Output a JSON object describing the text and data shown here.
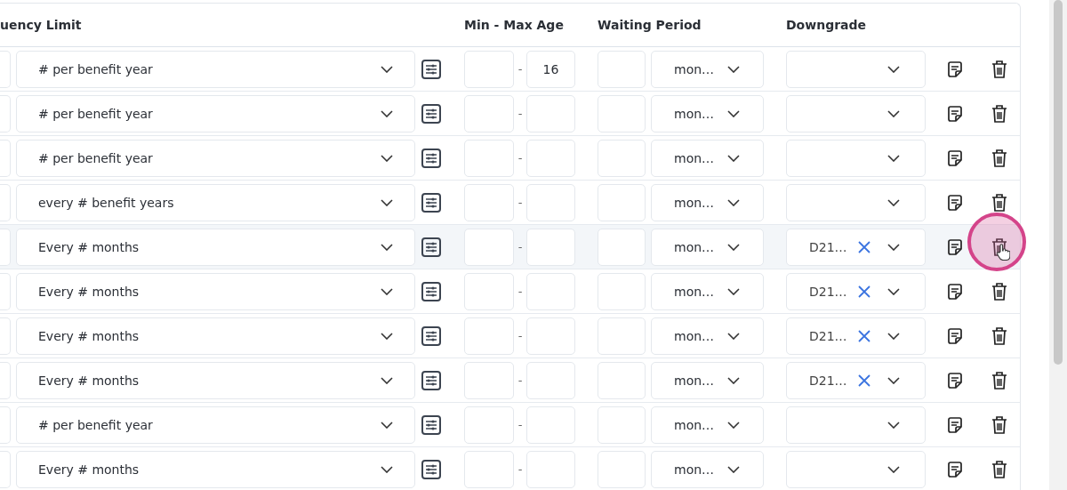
{
  "table": {
    "columns": [
      "uency Limit",
      "Min - Max Age",
      "Waiting Period",
      "Downgrade"
    ],
    "rows": [
      {
        "frequency": "# per benefit year",
        "age_separator": "-",
        "max_age": "16",
        "waiting_unit": "mon…",
        "downgrade": null,
        "hovered": false
      },
      {
        "frequency": "# per benefit year",
        "age_separator": "-",
        "max_age": null,
        "waiting_unit": "mon…",
        "downgrade": null,
        "hovered": false
      },
      {
        "frequency": "# per benefit year",
        "age_separator": "-",
        "max_age": null,
        "waiting_unit": "mon…",
        "downgrade": null,
        "hovered": false
      },
      {
        "frequency": "every # benefit years",
        "age_separator": "-",
        "max_age": null,
        "waiting_unit": "mon…",
        "downgrade": null,
        "hovered": false
      },
      {
        "frequency": "Every # months",
        "age_separator": "-",
        "max_age": null,
        "waiting_unit": "mon…",
        "downgrade": "D21…",
        "hovered": true
      },
      {
        "frequency": "Every # months",
        "age_separator": "-",
        "max_age": null,
        "waiting_unit": "mon…",
        "downgrade": "D21…",
        "hovered": false
      },
      {
        "frequency": "Every # months",
        "age_separator": "-",
        "max_age": null,
        "waiting_unit": "mon…",
        "downgrade": "D21…",
        "hovered": false
      },
      {
        "frequency": "Every # months",
        "age_separator": "-",
        "max_age": null,
        "waiting_unit": "mon…",
        "downgrade": "D21…",
        "hovered": false
      },
      {
        "frequency": "# per benefit year",
        "age_separator": "-",
        "max_age": null,
        "waiting_unit": "mon…",
        "downgrade": null,
        "hovered": false
      },
      {
        "frequency": "Every # months",
        "age_separator": "-",
        "max_age": null,
        "waiting_unit": "mon…",
        "downgrade": null,
        "hovered": false
      }
    ]
  }
}
